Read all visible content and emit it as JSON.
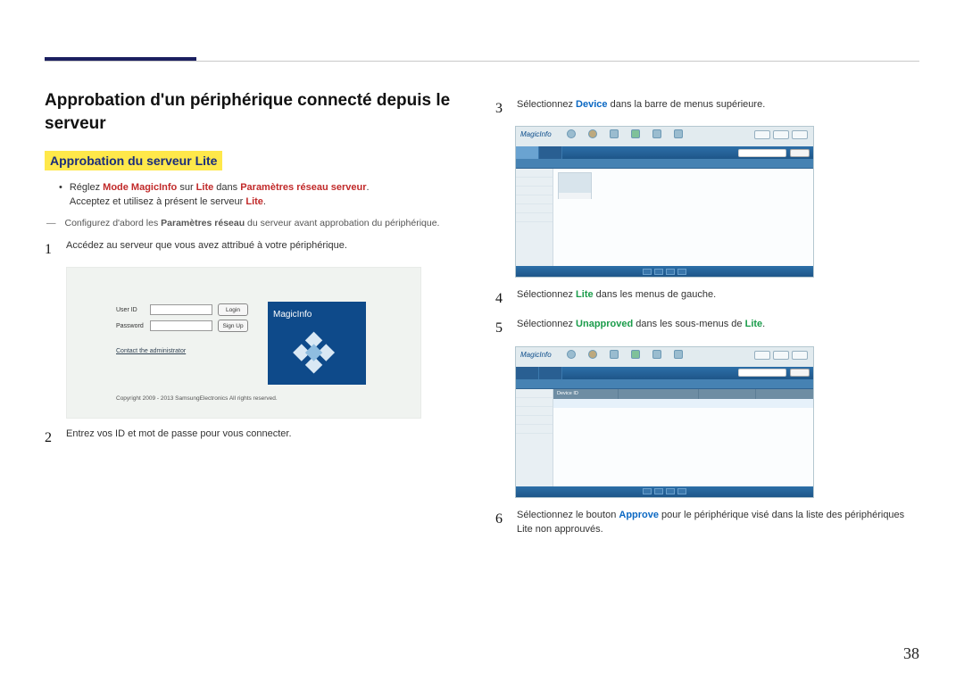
{
  "header": {
    "title": "Approbation d'un périphérique connecté depuis le serveur",
    "subtitle": "Approbation du serveur Lite"
  },
  "bullet": {
    "pre": "Réglez ",
    "mode": "Mode MagicInfo",
    "mid1": " sur ",
    "lite1": "Lite",
    "mid2": " dans ",
    "params": "Paramètres réseau serveur",
    "end": ".",
    "line2a": "Acceptez et utilisez à présent le serveur ",
    "line2b": "Lite",
    "line2c": "."
  },
  "note": {
    "pre": "Configurez d'abord les ",
    "bold": "Paramètres réseau",
    "post": " du serveur avant approbation du périphérique."
  },
  "steps": {
    "1": "Accédez au serveur que vous avez attribué à votre périphérique.",
    "2": "Entrez vos ID et mot de passe pour vous connecter.",
    "3a": "Sélectionnez ",
    "3b": "Device",
    "3c": " dans la barre de menus supérieure.",
    "4a": "Sélectionnez ",
    "4b": "Lite",
    "4c": " dans les menus de gauche.",
    "5a": "Sélectionnez ",
    "5b": "Unapproved",
    "5c": " dans les sous-menus de ",
    "5d": "Lite",
    "5e": ".",
    "6a": "Sélectionnez le bouton ",
    "6b": "Approve",
    "6c": " pour le périphérique visé dans la liste des périphériques Lite non approuvés."
  },
  "login": {
    "userid": "User ID",
    "password": "Password",
    "login": "Login",
    "signup": "Sign Up",
    "contact": "Contact the administrator",
    "copyright": "Copyright 2009 - 2013 SamsungElectronics All rights reserved.",
    "brand": "MagicInfo"
  },
  "app": {
    "brand": "MagicInfo",
    "listcol": "Device ID"
  },
  "numbers": {
    "1": "1",
    "2": "2",
    "3": "3",
    "4": "4",
    "5": "5",
    "6": "6"
  },
  "page_number": "38"
}
